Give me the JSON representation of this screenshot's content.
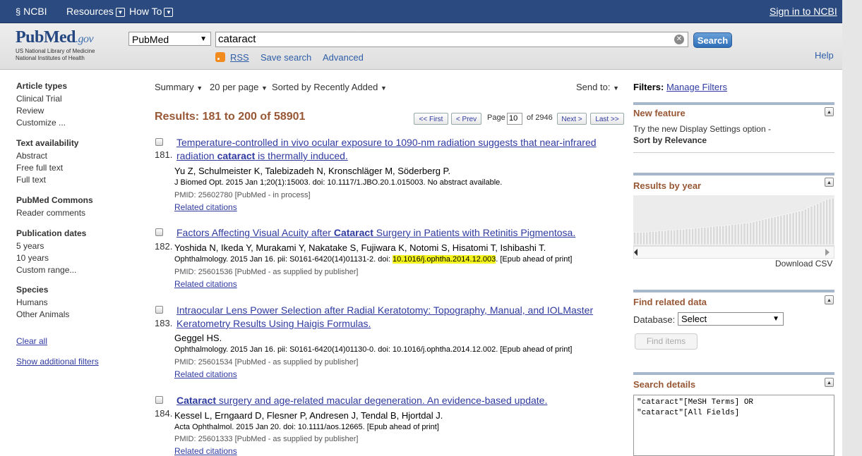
{
  "topbar": {
    "ncbi": "NCBI",
    "resources": "Resources",
    "howto": "How To",
    "signin": "Sign in to NCBI"
  },
  "header": {
    "logo": "PubMed",
    "logo_gov": ".gov",
    "logo_sub1": "US National Library of Medicine",
    "logo_sub2": "National Institutes of Health",
    "db_value": "PubMed",
    "search_value": "cataract",
    "search_btn": "Search",
    "rss": "RSS",
    "save_search": "Save search",
    "advanced": "Advanced",
    "help": "Help"
  },
  "sidebar": {
    "article_types": {
      "title": "Article types",
      "items": [
        "Clinical Trial",
        "Review",
        "Customize ..."
      ]
    },
    "text_availability": {
      "title": "Text availability",
      "items": [
        "Abstract",
        "Free full text",
        "Full text"
      ]
    },
    "commons": {
      "title": "PubMed Commons",
      "items": [
        "Reader comments"
      ]
    },
    "pub_dates": {
      "title": "Publication dates",
      "items": [
        "5 years",
        "10 years",
        "Custom range..."
      ]
    },
    "species": {
      "title": "Species",
      "items": [
        "Humans",
        "Other Animals"
      ]
    },
    "clear_all": "Clear all",
    "show_filters": "Show additional filters"
  },
  "controls": {
    "summary": "Summary",
    "per_page": "20 per page",
    "sort": "Sorted by Recently Added",
    "send_to": "Send to:"
  },
  "results": {
    "label": "Results: 181 to 200 of 58901"
  },
  "pager": {
    "first": "<< First",
    "prev": "< Prev",
    "page_label": "Page",
    "page": "10",
    "of": "of 2946",
    "next": "Next >",
    "last": "Last >>"
  },
  "articles": [
    {
      "num": "181.",
      "title_pre": "Temperature-controlled in vivo ocular exposure to 1090-nm radiation suggests that near-infrared radiation ",
      "title_bold": "cataract",
      "title_post": " is thermally induced.",
      "authors": "Yu Z, Schulmeister K, Talebizadeh N, Kronschläger M, Söderberg P.",
      "cite": "J Biomed Opt. 2015 Jan 1;20(1):15003. doi: 10.1117/1.JBO.20.1.015003. No abstract available.",
      "pmid": "PMID: 25602780 [PubMed - in process]",
      "related": "Related citations"
    },
    {
      "num": "182.",
      "title_pre": "Factors Affecting Visual Acuity after ",
      "title_bold": "Cataract",
      "title_post": " Surgery in Patients with Retinitis Pigmentosa.",
      "authors": "Yoshida N, Ikeda Y, Murakami Y, Nakatake S, Fujiwara K, Notomi S, Hisatomi T, Ishibashi T.",
      "cite_pre": "Ophthalmology. 2015 Jan 16. pii: S0161-6420(14)01131-2. doi: ",
      "cite_hl": "10.1016/j.ophtha.2014.12.003",
      "cite_post": ". [Epub ahead of print]",
      "pmid": "PMID: 25601536 [PubMed - as supplied by publisher]",
      "related": "Related citations"
    },
    {
      "num": "183.",
      "title": "Intraocular Lens Power Selection after Radial Keratotomy: Topography, Manual, and IOLMaster Keratometry Results Using Haigis Formulas.",
      "authors": "Geggel HS.",
      "cite": "Ophthalmology. 2015 Jan 16. pii: S0161-6420(14)01130-0. doi: 10.1016/j.ophtha.2014.12.002. [Epub ahead of print]",
      "pmid": "PMID: 25601534 [PubMed - as supplied by publisher]",
      "related": "Related citations"
    },
    {
      "num": "184.",
      "title_bold": "Cataract",
      "title_post": " surgery and age-related macular degeneration. An evidence-based update.",
      "authors": "Kessel L, Erngaard D, Flesner P, Andresen J, Tendal B, Hjortdal J.",
      "cite": "Acta Ophthalmol. 2015 Jan 20. doi: 10.1111/aos.12665. [Epub ahead of print]",
      "pmid": "PMID: 25601333 [PubMed - as supplied by publisher]",
      "related": "Related citations"
    }
  ],
  "right": {
    "filters_label": "Filters:",
    "manage_filters": "Manage Filters",
    "new_feature": {
      "title": "New feature",
      "line1": "Try the new Display Settings option -",
      "line2": "Sort by Relevance"
    },
    "results_by_year": {
      "title": "Results by year",
      "download": "Download CSV"
    },
    "find_related": {
      "title": "Find related data",
      "db_label": "Database:",
      "db_value": "Select",
      "button": "Find items"
    },
    "search_details": {
      "title": "Search details",
      "query": "\"cataract\"[MeSH Terms] OR\n\"cataract\"[All Fields]"
    }
  },
  "year_chart": {
    "bar_color": "#d9d9d9",
    "values": [
      18,
      18,
      18,
      18,
      18,
      19,
      19,
      19,
      20,
      20,
      20,
      21,
      21,
      21,
      22,
      22,
      22,
      23,
      23,
      23,
      24,
      24,
      25,
      25,
      25,
      26,
      26,
      27,
      27,
      27,
      28,
      28,
      29,
      29,
      30,
      30,
      31,
      31,
      32,
      33,
      34,
      35,
      36,
      37,
      38,
      39,
      40,
      41,
      42,
      43,
      44,
      45,
      46,
      47,
      48,
      49,
      51,
      53,
      55,
      57,
      59,
      61,
      63,
      65,
      66,
      67
    ]
  }
}
